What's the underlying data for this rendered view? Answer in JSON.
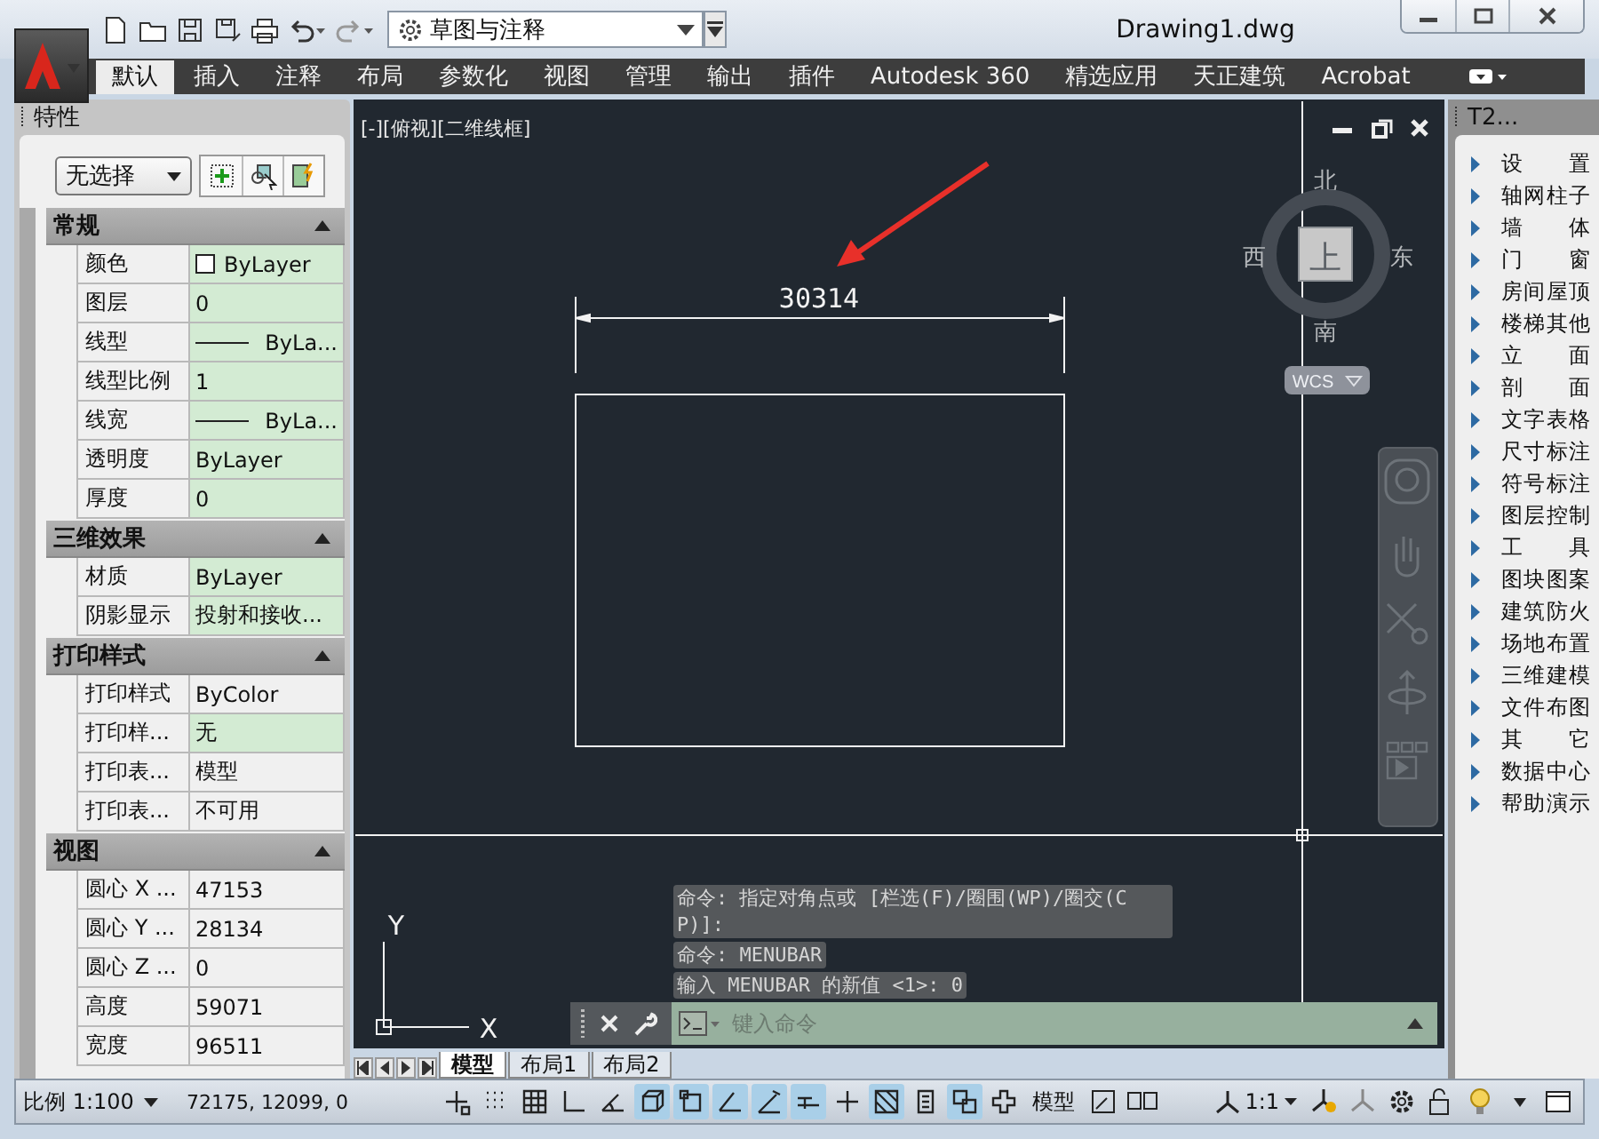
{
  "app": {
    "title": "Drawing1.dwg",
    "workspace": "草图与注释"
  },
  "ribbon_tabs": [
    {
      "label": "默认",
      "selected": true
    },
    {
      "label": "插入",
      "selected": false
    },
    {
      "label": "注释",
      "selected": false
    },
    {
      "label": "布局",
      "selected": false
    },
    {
      "label": "参数化",
      "selected": false
    },
    {
      "label": "视图",
      "selected": false
    },
    {
      "label": "管理",
      "selected": false
    },
    {
      "label": "输出",
      "selected": false
    },
    {
      "label": "插件",
      "selected": false
    },
    {
      "label": "Autodesk 360",
      "selected": false
    },
    {
      "label": "精选应用",
      "selected": false
    },
    {
      "label": "天正建筑",
      "selected": false
    },
    {
      "label": "Acrobat",
      "selected": false
    }
  ],
  "properties_panel": {
    "title": "特性",
    "selection": "无选择",
    "sections": [
      {
        "title": "常规",
        "expanded": true,
        "rows": [
          {
            "label": "颜色",
            "value": "ByLayer",
            "kind": "color",
            "highlighted": true
          },
          {
            "label": "图层",
            "value": "0",
            "kind": "text",
            "highlighted": true
          },
          {
            "label": "线型",
            "value": "ByLa...",
            "kind": "line",
            "highlighted": true
          },
          {
            "label": "线型比例",
            "value": "1",
            "kind": "text",
            "highlighted": true
          },
          {
            "label": "线宽",
            "value": "ByLa...",
            "kind": "line",
            "highlighted": true
          },
          {
            "label": "透明度",
            "value": "ByLayer",
            "kind": "text",
            "highlighted": true
          },
          {
            "label": "厚度",
            "value": "0",
            "kind": "text",
            "highlighted": true
          }
        ]
      },
      {
        "title": "三维效果",
        "expanded": true,
        "rows": [
          {
            "label": "材质",
            "value": "ByLayer",
            "kind": "text",
            "highlighted": true
          },
          {
            "label": "阴影显示",
            "value": "投射和接收...",
            "kind": "text",
            "highlighted": true
          }
        ]
      },
      {
        "title": "打印样式",
        "expanded": true,
        "rows": [
          {
            "label": "打印样式",
            "value": "ByColor",
            "kind": "text",
            "highlighted": false
          },
          {
            "label": "打印样...",
            "value": "无",
            "kind": "text",
            "highlighted": true
          },
          {
            "label": "打印表...",
            "value": "模型",
            "kind": "text",
            "highlighted": false
          },
          {
            "label": "打印表...",
            "value": "不可用",
            "kind": "text",
            "highlighted": false
          }
        ]
      },
      {
        "title": "视图",
        "expanded": true,
        "rows": [
          {
            "label": "圆心 X ...",
            "value": "47153",
            "kind": "text",
            "highlighted": false
          },
          {
            "label": "圆心 Y ...",
            "value": "28134",
            "kind": "text",
            "highlighted": false
          },
          {
            "label": "圆心 Z ...",
            "value": "0",
            "kind": "text",
            "highlighted": false
          },
          {
            "label": "高度",
            "value": "59071",
            "kind": "text",
            "highlighted": false
          },
          {
            "label": "宽度",
            "value": "96511",
            "kind": "text",
            "highlighted": false
          }
        ]
      }
    ]
  },
  "viewport": {
    "label": "[-][俯视][二维线框]",
    "dimension": "30314",
    "compass": {
      "north": "北",
      "south": "南",
      "west": "西",
      "east": "东",
      "face": "上",
      "ucs": "WCS"
    },
    "axis_x": "X",
    "axis_y": "Y"
  },
  "command_line": {
    "history": [
      "命令: 指定对角点或 [栏选(F)/圈围(WP)/圈交(CP)]:",
      "命令: MENUBAR",
      "输入 MENUBAR 的新值 <1>: 0"
    ],
    "placeholder": "键入命令"
  },
  "layout_tabs": [
    {
      "label": "模型",
      "selected": true
    },
    {
      "label": "布局1",
      "selected": false
    },
    {
      "label": "布局2",
      "selected": false
    }
  ],
  "tool_panel": {
    "title": "T2...",
    "items": [
      "设 置",
      "轴网柱子",
      "墙 体",
      "门 窗",
      "房间屋顶",
      "楼梯其他",
      "立 面",
      "剖 面",
      "文字表格",
      "尺寸标注",
      "符号标注",
      "图层控制",
      "工 具",
      "图块图案",
      "建筑防火",
      "场地布置",
      "三维建模",
      "文件布图",
      "其 它",
      "数据中心",
      "帮助演示"
    ]
  },
  "status_bar": {
    "scale": "比例 1:100",
    "coordinates": "72175, 12099, 0",
    "model": "模型",
    "annotation_scale": "1:1",
    "toggles": [
      {
        "kind": "infer",
        "on": false
      },
      {
        "kind": "snap",
        "on": false
      },
      {
        "kind": "grid",
        "on": false
      },
      {
        "kind": "ortho",
        "on": false
      },
      {
        "kind": "polar",
        "on": false
      },
      {
        "kind": "osnap3d",
        "on": true
      },
      {
        "kind": "osnap",
        "on": true
      },
      {
        "kind": "track",
        "on": true
      },
      {
        "kind": "ducs",
        "on": true
      },
      {
        "kind": "dyn",
        "on": true
      },
      {
        "kind": "lineweight",
        "on": false
      },
      {
        "kind": "transparency",
        "on": true
      },
      {
        "kind": "qp",
        "on": false
      },
      {
        "kind": "cycle",
        "on": true
      },
      {
        "kind": "monitor",
        "on": false
      }
    ]
  }
}
